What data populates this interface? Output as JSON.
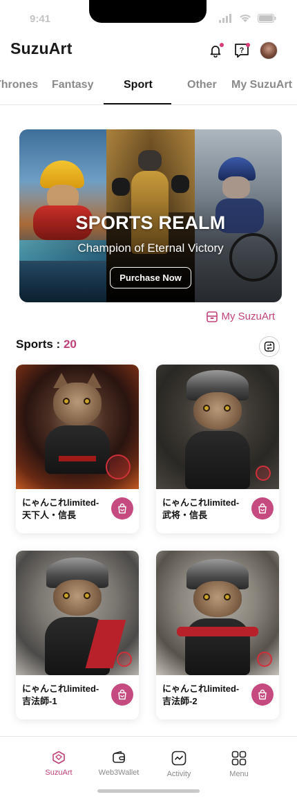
{
  "status_bar": {
    "time": "9:41"
  },
  "header": {
    "title": "SuzuArt"
  },
  "tabs": [
    {
      "label": "Thrones"
    },
    {
      "label": "Fantasy"
    },
    {
      "label": "Sport"
    },
    {
      "label": "Other"
    },
    {
      "label": "My SuzuArt"
    }
  ],
  "active_tab": "Sport",
  "banner": {
    "title": "SPORTS REALM",
    "subtitle": "Champion of Eternal Victory",
    "button_label": "Purchase Now"
  },
  "my_suzuart_link": "My SuzuArt",
  "section": {
    "label": "Sports :",
    "count": "20"
  },
  "cards": [
    {
      "name": "にゃんこれlimited-\n天下人・信長"
    },
    {
      "name": "にゃんこれlimited-\n武将・信長"
    },
    {
      "name": "にゃんこれlimited-\n吉法師-1"
    },
    {
      "name": "にゃんこれlimited-\n吉法師-2"
    }
  ],
  "bottom_nav": [
    {
      "label": "SuzuArt",
      "icon": "cube-icon",
      "active": true
    },
    {
      "label": "Web3Wallet",
      "icon": "wallet-icon",
      "active": false
    },
    {
      "label": "Activity",
      "icon": "activity-icon",
      "active": false
    },
    {
      "label": "Menu",
      "icon": "grid-icon",
      "active": false
    }
  ],
  "colors": {
    "accent": "#c0417a",
    "bag_button": "#c54a7f",
    "notification_dot": "#d93a78"
  }
}
